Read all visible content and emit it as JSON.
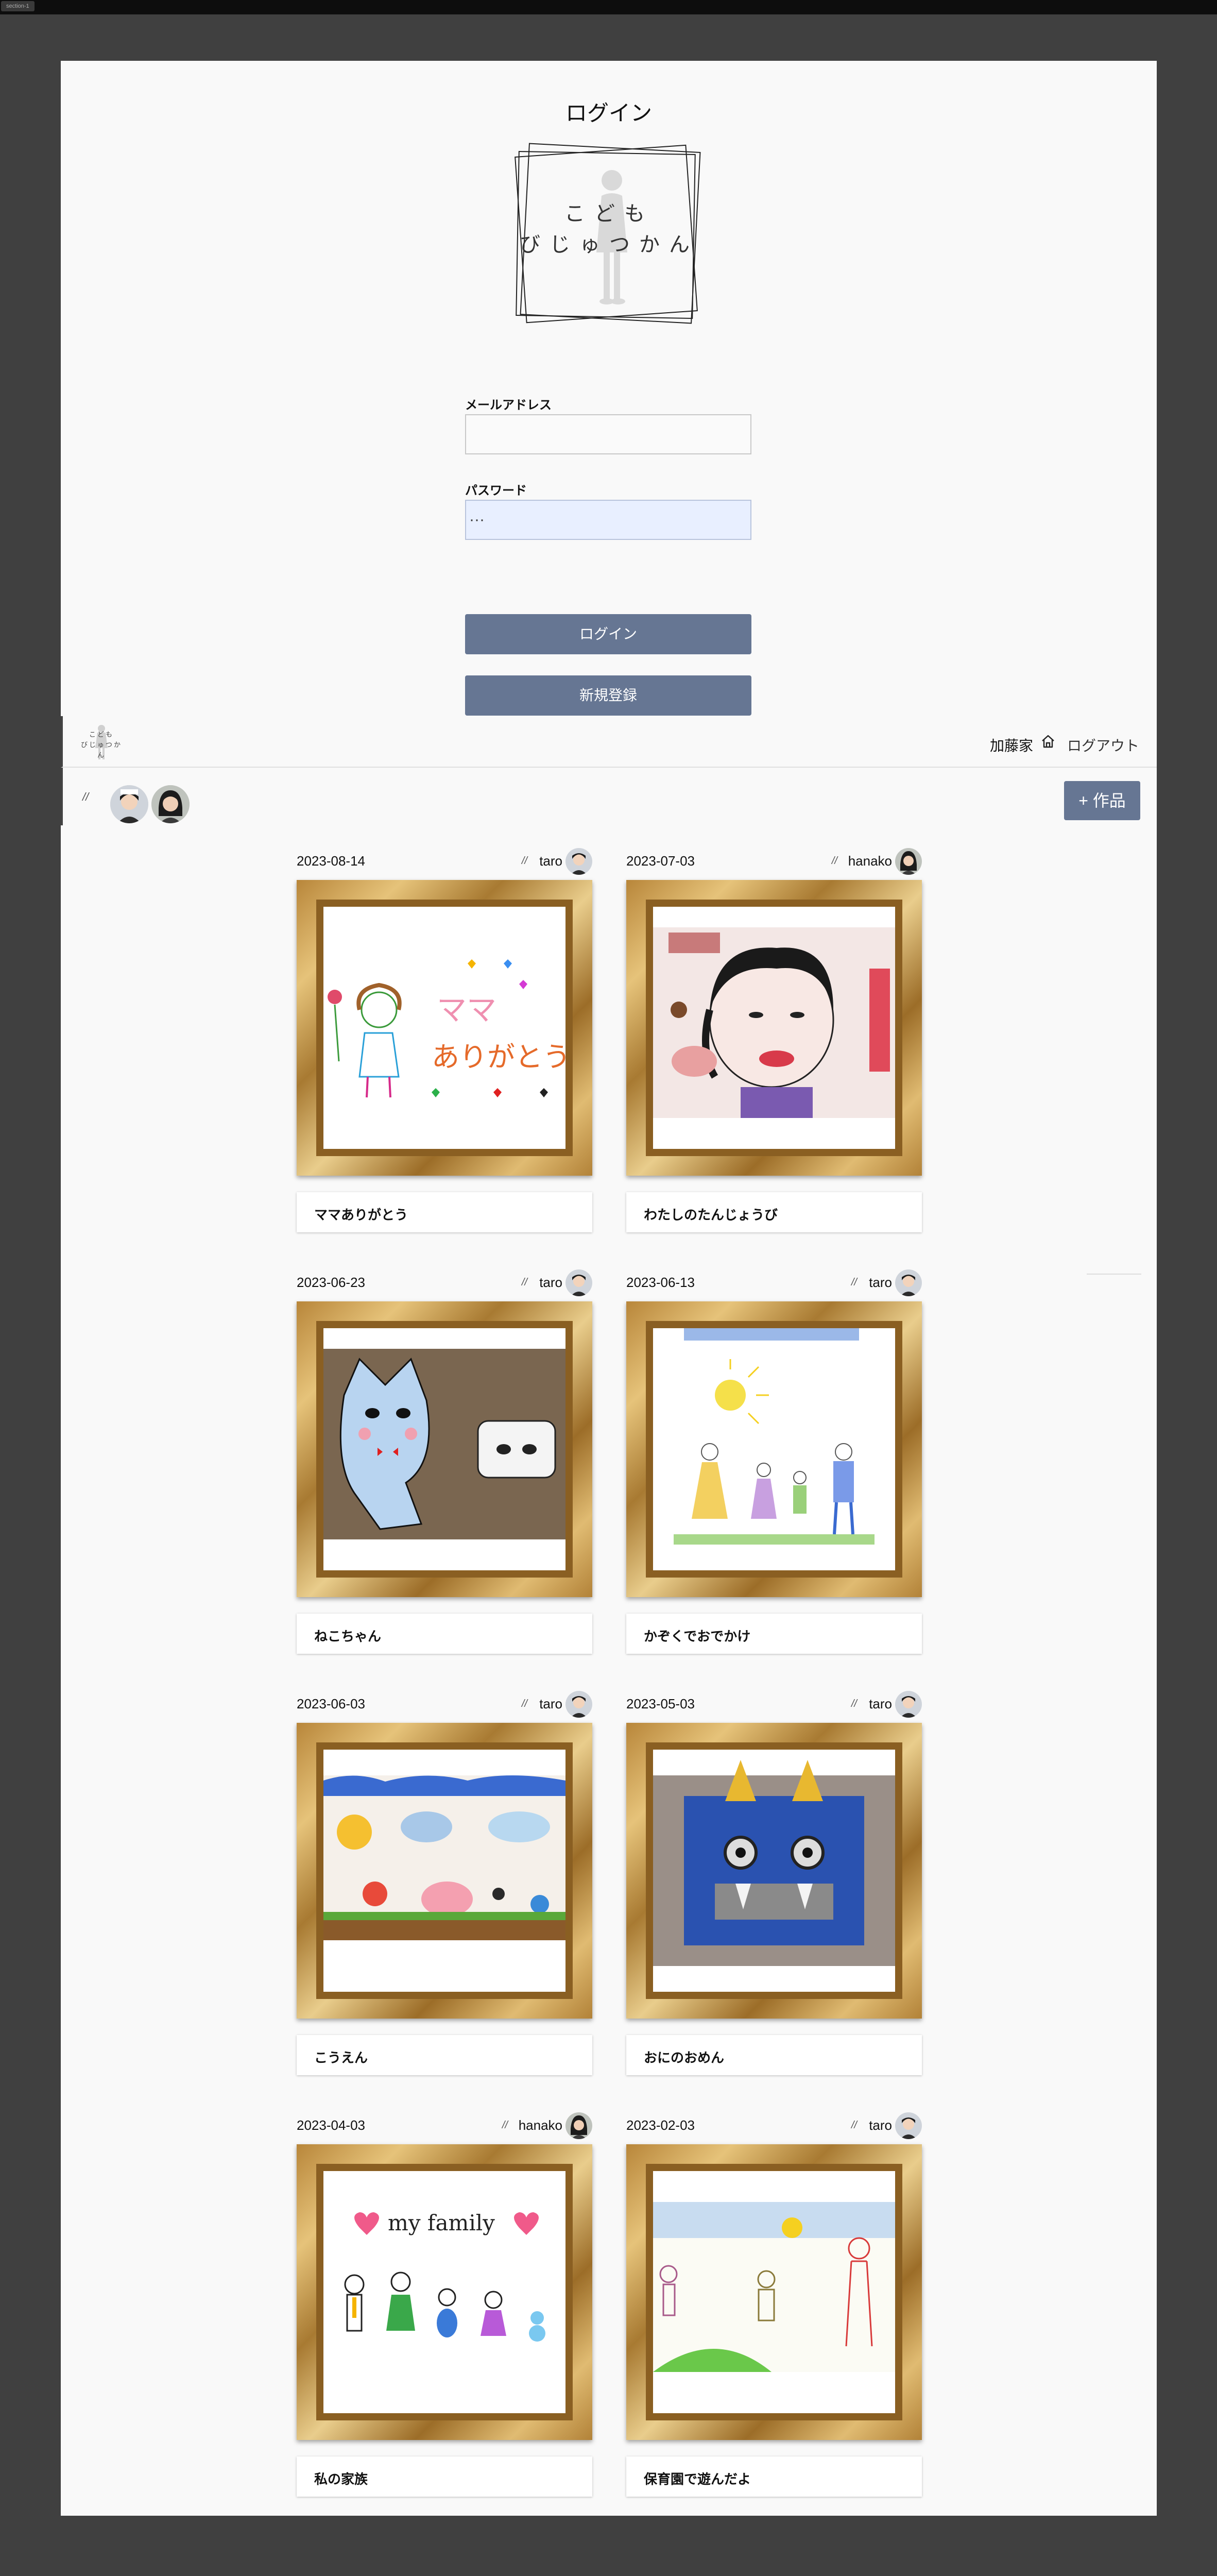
{
  "section_tag": "section-1",
  "login": {
    "title": "ログイン",
    "logo_line1": "こども",
    "logo_line2": "びじゅつかん",
    "email_label": "メールアドレス",
    "email_value": "",
    "password_label": "パスワード",
    "password_value": "···",
    "login_button": "ログイン",
    "signup_button": "新規登録"
  },
  "header": {
    "logo_line1": "こども",
    "logo_line2": "びじゅつかん",
    "family_name": "加藤家",
    "home_icon": "home-icon",
    "logout": "ログアウト"
  },
  "member_bar": {
    "slash": "//",
    "members": [
      "taro",
      "hanako"
    ],
    "add_button": "+ 作品"
  },
  "artworks": [
    {
      "date": "2023-08-14",
      "author": "taro",
      "title": "ママありがとう"
    },
    {
      "date": "2023-07-03",
      "author": "hanako",
      "title": "わたしのたんじょうび"
    },
    {
      "date": "2023-06-23",
      "author": "taro",
      "title": "ねこちゃん"
    },
    {
      "date": "2023-06-13",
      "author": "taro",
      "title": "かぞくでおでかけ"
    },
    {
      "date": "2023-06-03",
      "author": "taro",
      "title": "こうえん"
    },
    {
      "date": "2023-05-03",
      "author": "taro",
      "title": "おにのおめん"
    },
    {
      "date": "2023-04-03",
      "author": "hanako",
      "title": "私の家族"
    },
    {
      "date": "2023-02-03",
      "author": "taro",
      "title": "保育園で遊んだよ"
    }
  ],
  "artwork_slash": "//",
  "drawing_text": {
    "mama": "ママ",
    "arigatou": "ありがとう",
    "my_family": "my family"
  },
  "colors": {
    "button": "#667693",
    "frame_gold": "#c99a4e",
    "page_bg": "#f9f9f9",
    "outer_bg": "#404040"
  }
}
